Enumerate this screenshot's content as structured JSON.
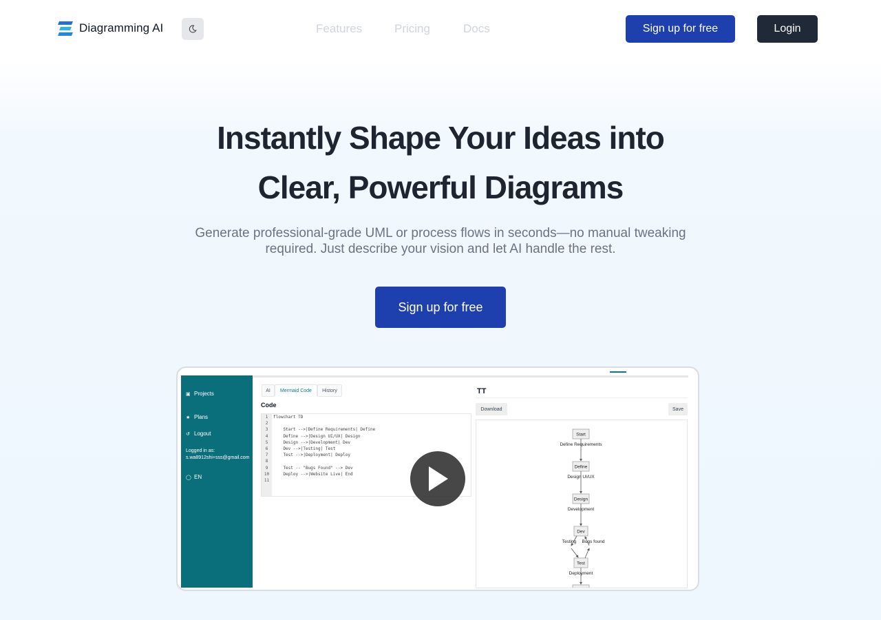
{
  "header": {
    "brand": "Diagramming AI",
    "theme_icon": "moon-icon",
    "nav": [
      "Features",
      "Pricing",
      "Docs"
    ],
    "signup_label": "Sign up for free",
    "login_label": "Login"
  },
  "hero": {
    "title_line1": "Instantly Shape Your Ideas into",
    "title_line2": "Clear, Powerful Diagrams",
    "subtitle_line1": "Generate professional-grade UML or process flows in seconds—no manual tweaking",
    "subtitle_line2": "required. Just describe your vision and let AI handle the rest.",
    "cta_label": "Sign up for free"
  },
  "preview": {
    "sidebar": {
      "projects": "Projects",
      "plans": "Plans",
      "logout": "Logout",
      "logged_in_label": "Logged in as:",
      "email": "s.wa8912shi+sss@gmail.com",
      "language": "EN"
    },
    "tabs": [
      "AI",
      "Mermaid Code",
      "History"
    ],
    "code_label": "Code",
    "code_lines": [
      "flowchart TD",
      "",
      "    Start -->|Define Requirements| Define",
      "    Define -->|Design UI/UX| Design",
      "    Design -->|Development| Dev",
      "    Dev -->|Testing| Test",
      "    Test -->|Deployment| Deploy",
      "",
      "    Test -- \"Bugs Found\" --> Dev",
      "    Deploy -->|Website Live| End",
      ""
    ],
    "line_numbers": [
      "1",
      "2",
      "3",
      "4",
      "5",
      "6",
      "7",
      "8",
      "9",
      "10",
      "11"
    ],
    "diagram_title": "TT",
    "download_label": "Download",
    "save_label": "Save",
    "flow": {
      "nodes": [
        "Start",
        "Define",
        "Design",
        "Dev",
        "Test"
      ],
      "edges": [
        "Define Requirements",
        "Design UI/UX",
        "Development",
        "Testing",
        "Bugs found",
        "Deployment"
      ]
    },
    "colors": {
      "sidebar": "#0b6e7b",
      "accent": "#1e40af",
      "dark": "#1f2937"
    }
  }
}
